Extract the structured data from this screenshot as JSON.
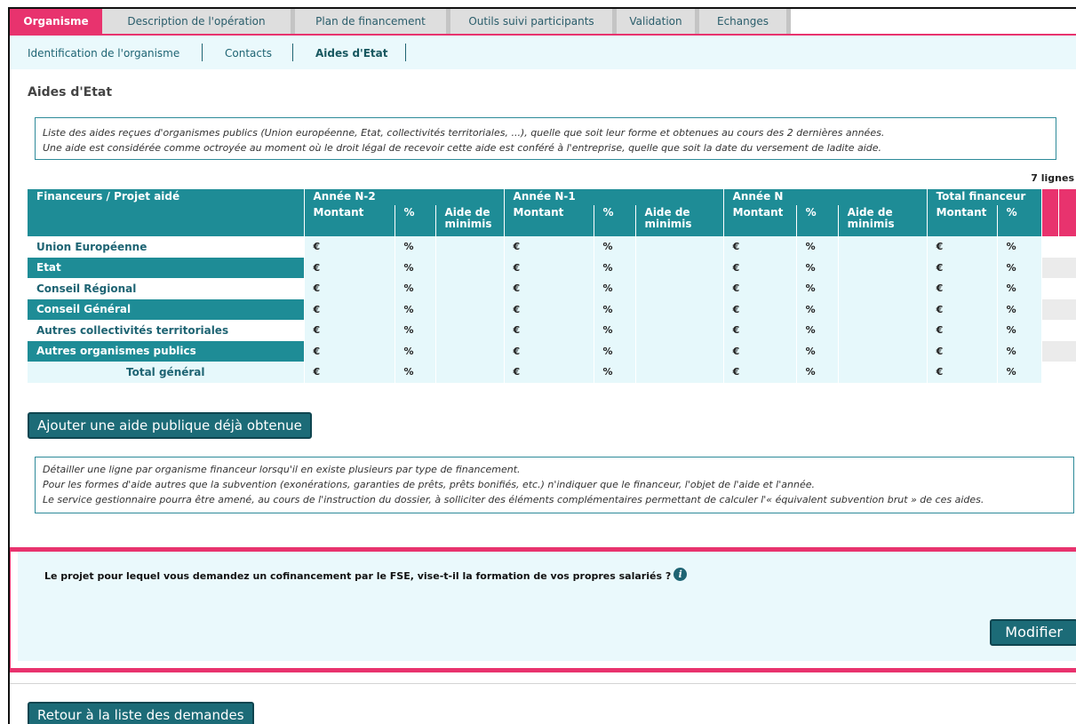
{
  "tabs": [
    {
      "label": "Organisme",
      "active": true
    },
    {
      "label": "Description de l'opération",
      "active": false
    },
    {
      "label": "Plan de financement",
      "active": false
    },
    {
      "label": "Outils suivi participants",
      "active": false
    },
    {
      "label": "Validation",
      "active": false
    },
    {
      "label": "Echanges",
      "active": false
    }
  ],
  "subnav": {
    "items": [
      "Identification de l'organisme",
      "Contacts",
      "Aides d'Etat"
    ],
    "active": "Aides d'Etat"
  },
  "page_title": "Aides d'Etat",
  "intro_box": {
    "line1": "Liste des aides reçues d'organismes publics (Union européenne, Etat, collectivités territoriales, ...), quelle que soit leur forme et obtenues au cours des 2 dernières années.",
    "line2": "Une aide est considérée comme octroyée au moment où le droit légal de recevoir cette aide est conféré à l'entreprise, quelle que soit la date du versement de ladite aide."
  },
  "row_count": "7 lignes",
  "table": {
    "header_funder": "Financeurs / Projet aidé",
    "groups": [
      "Année N-2",
      "Année N-1",
      "Année N",
      "Total financeur"
    ],
    "sub_amount": "Montant",
    "sub_pct": "%",
    "sub_minimis": "Aide de minimis",
    "currency": "€",
    "percent": "%",
    "rows": [
      {
        "label": "Union Européenne",
        "shaded": false
      },
      {
        "label": "Etat",
        "shaded": true
      },
      {
        "label": "Conseil Régional",
        "shaded": false
      },
      {
        "label": "Conseil Général",
        "shaded": true
      },
      {
        "label": "Autres collectivités territoriales",
        "shaded": false
      },
      {
        "label": "Autres organismes publics",
        "shaded": true
      }
    ],
    "total_label": "Total général"
  },
  "add_button": "Ajouter une aide publique déjà obtenue",
  "detail_box": {
    "line1": "Détailler une ligne par organisme financeur lorsqu'il en existe plusieurs par type de financement.",
    "line2": "Pour les formes d'aide autres que la subvention (exonérations, garanties de prêts, prêts bonifiés, etc.) n'indiquer que le financeur, l'objet de l'aide et l'année.",
    "line3": "Le service gestionnaire pourra être amené, au cours de l'instruction du dossier, à solliciter des éléments complémentaires permettant de calculer l'« équivalent subvention brut » de ces aides."
  },
  "question": {
    "text": "Le projet pour lequel vous demandez un cofinancement par le FSE, vise-t-il la formation de vos propres salariés ?",
    "info_glyph": "i"
  },
  "modify_button": "Modifier",
  "back_button": "Retour à la liste des demandes",
  "colors": {
    "accent": "#e8336e",
    "teal": "#1e8c96",
    "dark_teal": "#1c6b77",
    "light_bg": "#eaf9fc"
  }
}
